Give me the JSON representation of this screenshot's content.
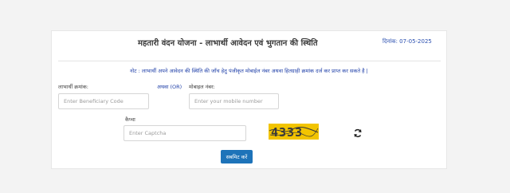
{
  "header": {
    "title": "महतारी वंदन योजना - लाभार्थी आवेदन एवं भुगतान की स्थिति",
    "date": "दिनांक: 07-05-2025"
  },
  "note": "नोट : लाभार्थी अपने आवेदन की स्थिति की जाँच हेतु पंजीकृत मोबाईल नंबर अथवा हितग्राही क्रमांक दर्ज कर प्राप्त कर सकते है |",
  "form": {
    "beneficiary_label": "लाभार्थी क्रमांक:",
    "beneficiary_placeholder": "Enter Beneficiary Code",
    "or_text": "अथवा (OR)",
    "mobile_label": "मोबाइल नंबर:",
    "mobile_placeholder": "Enter your mobile number",
    "captcha_label": "कैप्चा",
    "captcha_placeholder": "Enter Captcha",
    "captcha_text": "4333",
    "submit_label": "सबमिट करें"
  },
  "icons": {
    "refresh": "refresh-icon"
  },
  "colors": {
    "primary_button": "#1d73b9",
    "note_text": "#1f3fa8",
    "captcha_background": "#f2c400"
  }
}
